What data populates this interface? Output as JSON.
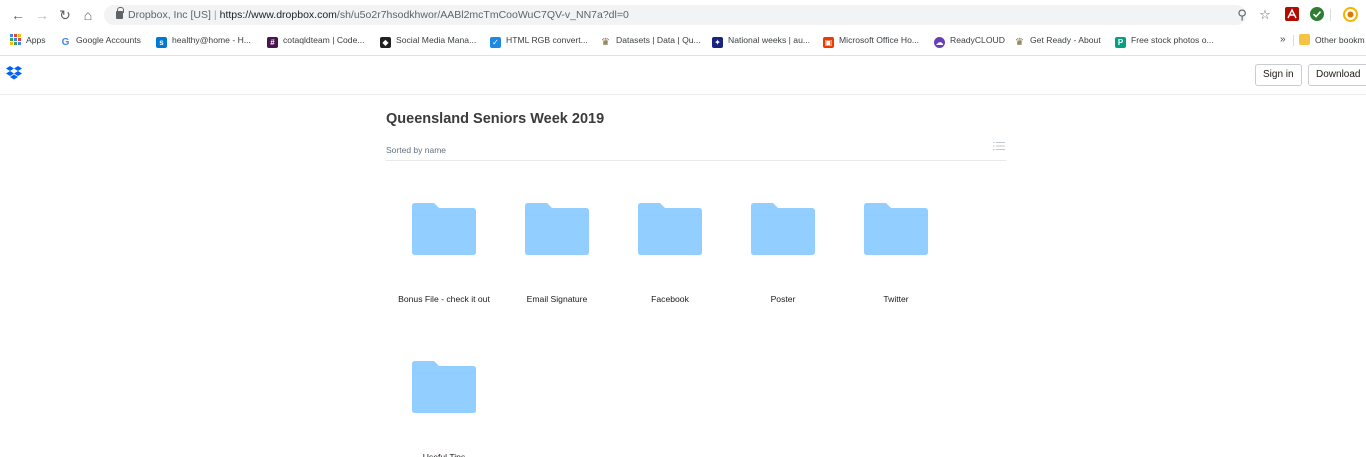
{
  "browser": {
    "site_identity": "Dropbox, Inc [US]",
    "url_host": "https://www.dropbox.com",
    "url_path": "/sh/u5o2r7hsodkhwor/AABl2mcTmCooWuC7QV-v_NN7a?dl=0",
    "nav_icons": [
      "back-arrow-icon",
      "forward-arrow-icon",
      "reload-icon",
      "home-icon"
    ],
    "bookmarks": [
      {
        "label": "Apps",
        "icon": "apps-grid-icon",
        "color": "#4285f4"
      },
      {
        "label": "Google Accounts",
        "icon": "google-icon",
        "color": "#4285f4"
      },
      {
        "label": "healthy@home - H...",
        "icon": "sharepoint-icon",
        "color": "#0078d4"
      },
      {
        "label": "cotaqldteam | Code...",
        "icon": "slack-icon",
        "color": "#4a154b"
      },
      {
        "label": "Social Media Mana...",
        "icon": "hootsuite-icon",
        "color": "#222222"
      },
      {
        "label": "HTML RGB convert...",
        "icon": "checkbox-favicon-icon",
        "color": "#1e88e5"
      },
      {
        "label": "Datasets | Data | Qu...",
        "icon": "crest-icon",
        "color": "#7a6a3a"
      },
      {
        "label": "National weeks | au...",
        "icon": "flag-icon",
        "color": "#1a237e"
      },
      {
        "label": "Microsoft Office Ho...",
        "icon": "office-icon",
        "color": "#eb3c00"
      },
      {
        "label": "ReadyCLOUD",
        "icon": "readycloud-icon",
        "color": "#6a3fb5"
      },
      {
        "label": "Get Ready - About",
        "icon": "crest-icon",
        "color": "#7a6a3a"
      },
      {
        "label": "Free stock photos o...",
        "icon": "pexels-icon",
        "color": "#05a081"
      },
      {
        "label": "»",
        "icon": "",
        "color": "#5f6368"
      },
      {
        "label": "Other bookm",
        "icon": "folder-icon",
        "color": "#f6c344"
      }
    ]
  },
  "header": {
    "sign_in_label": "Sign in",
    "download_label": "Download",
    "brand_color": "#0061fe"
  },
  "main": {
    "title": "Queensland Seniors Week 2019",
    "sort_label": "Sorted by name",
    "folder_color": "#92ceff",
    "folders": [
      {
        "name": "Bonus File - check it out"
      },
      {
        "name": "Email Signature"
      },
      {
        "name": "Facebook"
      },
      {
        "name": "Poster"
      },
      {
        "name": "Twitter"
      },
      {
        "name": "Useful Tips"
      }
    ]
  }
}
